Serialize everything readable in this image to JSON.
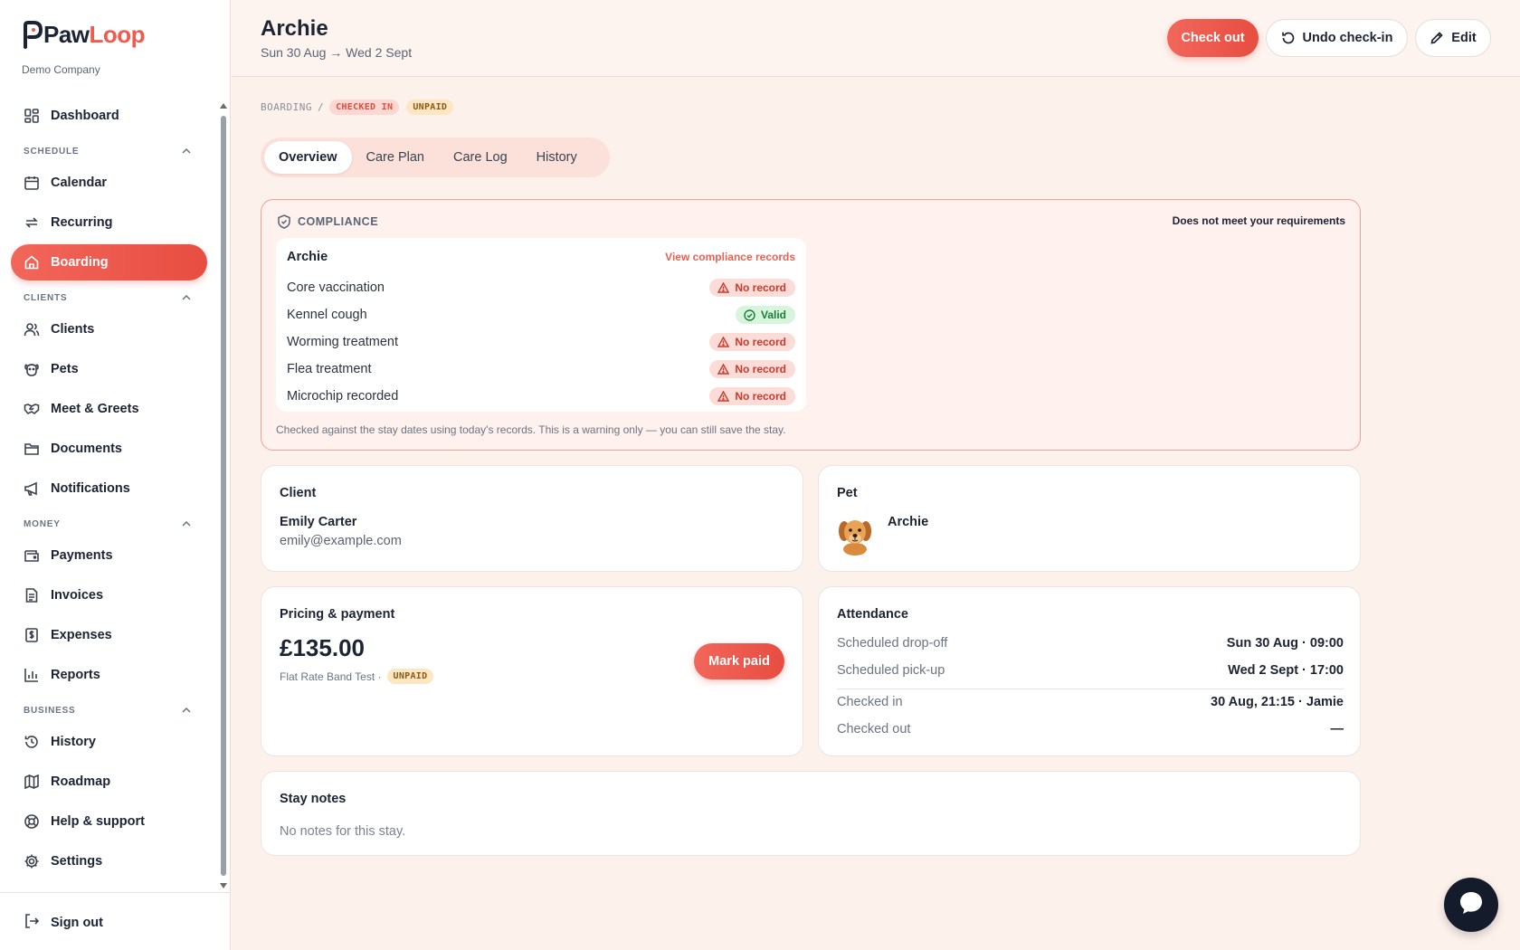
{
  "app": {
    "brand_paw": "Paw",
    "brand_loop": "Loop",
    "company": "Demo Company"
  },
  "sidebar": {
    "dashboard": "Dashboard",
    "sections": {
      "schedule": "SCHEDULE",
      "clients": "CLIENTS",
      "money": "MONEY",
      "business": "BUSINESS"
    },
    "items": {
      "calendar": "Calendar",
      "recurring": "Recurring",
      "boarding": "Boarding",
      "clients": "Clients",
      "pets": "Pets",
      "meet_greets": "Meet & Greets",
      "documents": "Documents",
      "notifications": "Notifications",
      "payments": "Payments",
      "invoices": "Invoices",
      "expenses": "Expenses",
      "reports": "Reports",
      "history": "History",
      "roadmap": "Roadmap",
      "help": "Help & support",
      "settings": "Settings"
    },
    "signout": "Sign out"
  },
  "header": {
    "title": "Archie",
    "dates": "Sun 30 Aug → Wed 2 Sept",
    "checkout_label": "Check out",
    "undo_label": "Undo check-in",
    "edit_label": "Edit"
  },
  "breadcrumb": {
    "section": "BOARDING",
    "sep": "/",
    "status": "CHECKED IN",
    "payment": "UNPAID"
  },
  "tabs": [
    "Overview",
    "Care Plan",
    "Care Log",
    "History"
  ],
  "compliance": {
    "heading": "COMPLIANCE",
    "warning": "Does not meet your requirements",
    "pet": "Archie",
    "view_link": "View compliance records",
    "rows": [
      {
        "label": "Core vaccination",
        "status": "No record"
      },
      {
        "label": "Kennel cough",
        "status": "Valid"
      },
      {
        "label": "Worming treatment",
        "status": "No record"
      },
      {
        "label": "Flea treatment",
        "status": "No record"
      },
      {
        "label": "Microchip recorded",
        "status": "No record"
      }
    ],
    "footnote": "Checked against the stay dates using today's records. This is a warning only — you can still save the stay."
  },
  "client": {
    "title": "Client",
    "name": "Emily Carter",
    "email": "emily@example.com"
  },
  "pet": {
    "title": "Pet",
    "name": "Archie"
  },
  "pricing": {
    "title": "Pricing & payment",
    "amount": "£135.00",
    "band": "Flat Rate Band Test ·",
    "badge": "UNPAID",
    "mark_paid": "Mark paid"
  },
  "attendance": {
    "title": "Attendance",
    "dropoff_label": "Scheduled drop-off",
    "dropoff_value": "Sun 30 Aug · 09:00",
    "pickup_label": "Scheduled pick-up",
    "pickup_value": "Wed 2 Sept · 17:00",
    "checkedin_label": "Checked in",
    "checkedin_value": "30 Aug, 21:15 · Jamie",
    "checkedout_label": "Checked out",
    "checkedout_value": "—"
  },
  "notes": {
    "title": "Stay notes",
    "text": "No notes for this stay."
  },
  "colors": {
    "accent": "#ef5b4c",
    "background": "#fdf1ec",
    "valid": "#1f7a3a",
    "warning": "#c43b2f"
  }
}
